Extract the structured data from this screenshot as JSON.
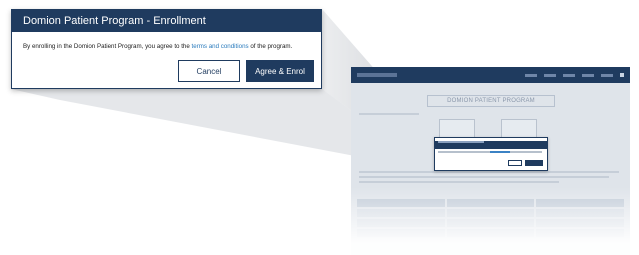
{
  "modal": {
    "title": "Domion Patient Program - Enrollment",
    "body_prefix": "By enrolling in the Domion Patient Program, you agree to the ",
    "body_link": "terms and conditions",
    "body_suffix": " of the program.",
    "cancel_label": "Cancel",
    "agree_label": "Agree & Enrol"
  },
  "background_page": {
    "page_title": "DOMION PATIENT PROGRAM"
  },
  "colors": {
    "brand_navy": "#1f3b5f",
    "link_blue": "#2a7bbd",
    "backdrop": "#dfe4ea"
  }
}
